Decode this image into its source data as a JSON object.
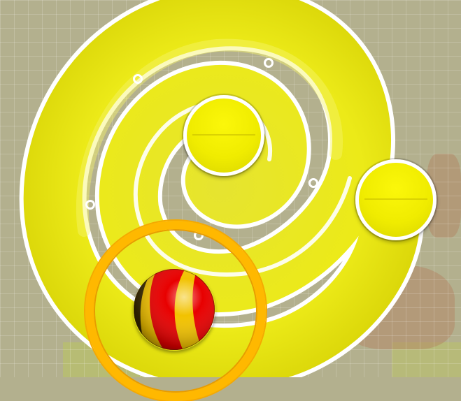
{
  "game": {
    "track_color": "#ecea1a",
    "track_outline_color": "#ffffff",
    "background_color": "#b3b08e",
    "target_ring_color": "#ffb800",
    "ball_colors": [
      "#e80000",
      "#f2c200",
      "#3a2a00"
    ],
    "elements": [
      "spiral-track",
      "peg-hole",
      "end-cap",
      "target-ring",
      "striped-ball"
    ]
  }
}
